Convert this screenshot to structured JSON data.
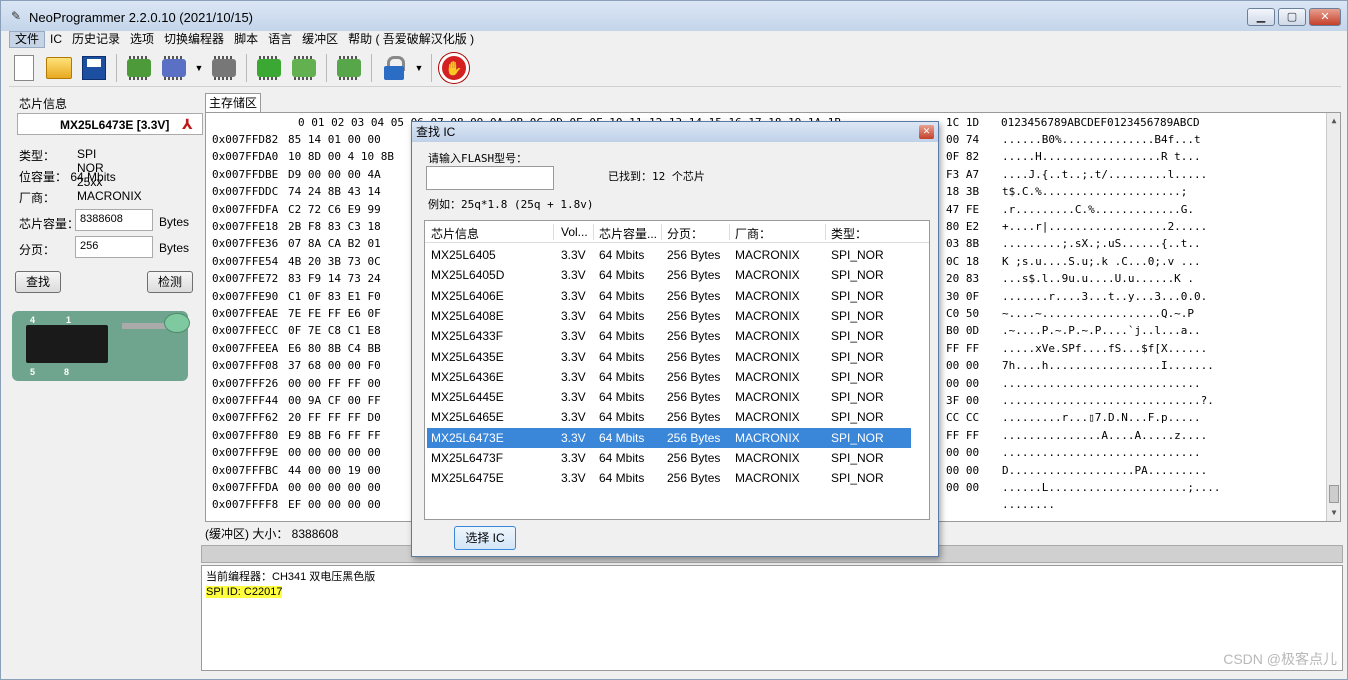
{
  "window": {
    "title": "NeoProgrammer 2.2.0.10 (2021/10/15)"
  },
  "menu": [
    "文件",
    "IC",
    "历史记录",
    "选项",
    "切换编程器",
    "脚本",
    "语言",
    "缓冲区",
    "帮助 ( 吾爱破解汉化版 )"
  ],
  "left_panel": {
    "group_label": "芯片信息",
    "chip_name": "MX25L6473E [3.3V]",
    "type_label": "类型：",
    "type_value": "SPI NOR 25xx",
    "capacity_label": "位容量：",
    "capacity_value": "64 Mbits",
    "vendor_label": "厂商：",
    "vendor_value": "MACRONIX",
    "chip_size_label": "芯片容量：",
    "chip_size_value": "8388608",
    "chip_size_unit": "Bytes",
    "page_label": "分页：",
    "page_value": "256",
    "page_unit": "Bytes",
    "find_button": "查找",
    "detect_button": "检测",
    "pin_1": "1",
    "pin_4": "4",
    "pin_5": "5",
    "pin_8": "8"
  },
  "main": {
    "tab_label": "主存储区",
    "hex_header": "0 01 02 03 04 05 06 07 08 09 0A 0B 0C 0D 0E 0F 10 11 12 13 14 15 16 17 18 19 1A 1B",
    "hex_header_tail": "1C 1D",
    "ascii_header": "0123456789ABCDEF0123456789ABCD",
    "rows": [
      {
        "addr": "0x007FFD82",
        "bytes": "85 14 01 00 00",
        "tail": "00 74",
        "ascii": "......B0%..............B4f...t"
      },
      {
        "addr": "0x007FFDA0",
        "bytes": "10 8D 00 4 10 8B",
        "tail": "0F 82",
        "ascii": ".....H..................R t..."
      },
      {
        "addr": "0x007FFDBE",
        "bytes": "D9 00 00 00 4A",
        "tail": "F3 A7",
        "ascii": "....J.{..t..;.t/.........l....."
      },
      {
        "addr": "0x007FFDDC",
        "bytes": "74 24 8B 43 14",
        "tail": "18 3B",
        "ascii": "t$.C.%.....................;"
      },
      {
        "addr": "0x007FFDFA",
        "bytes": "C2 72 C6 E9 99",
        "tail": "47 FE",
        "ascii": ".r.........C.%.............G."
      },
      {
        "addr": "0x007FFE18",
        "bytes": "2B F8 83 C3 18",
        "tail": "80 E2",
        "ascii": "+....r|..................2....."
      },
      {
        "addr": "0x007FFE36",
        "bytes": "07 8A CA B2 01",
        "tail": "03 8B",
        "ascii": ".........;.sX.;.uS......{..t.."
      },
      {
        "addr": "0x007FFE54",
        "bytes": "4B 20 3B 73 0C",
        "tail": "0C 18",
        "ascii": "K ;s.u....S.u;.k .C...0;.v ..."
      },
      {
        "addr": "0x007FFE72",
        "bytes": "83 F9 14 73 24",
        "tail": "20 83",
        "ascii": "...s$.l..9u.u....U.u......K ."
      },
      {
        "addr": "0x007FFE90",
        "bytes": "C1 0F 83 E1 F0",
        "tail": "30 0F",
        "ascii": ".......r....3...t..y...3...0.0."
      },
      {
        "addr": "0x007FFEAE",
        "bytes": "7E FE FF E6 0F",
        "tail": "C0 50",
        "ascii": "~....~..................Q.~.P"
      },
      {
        "addr": "0x007FFECC",
        "bytes": "0F 7E C8 C1 E8",
        "tail": "B0 0D",
        "ascii": ".~....P.~.P.~.P....`j..l...a.."
      },
      {
        "addr": "0x007FFEEA",
        "bytes": "E6 80 8B C4 BB",
        "tail": "FF FF",
        "ascii": ".....xVe.SPf....fS...$f[X......"
      },
      {
        "addr": "0x007FFF08",
        "bytes": "37 68 00 00 F0",
        "tail": "00 00",
        "ascii": "7h....h.................I......."
      },
      {
        "addr": "0x007FFF26",
        "bytes": "00 00 FF FF 00",
        "tail": "00 00",
        "ascii": ".............................."
      },
      {
        "addr": "0x007FFF44",
        "bytes": "00 9A CF 00 FF",
        "tail": "3F 00",
        "ascii": "..............................?."
      },
      {
        "addr": "0x007FFF62",
        "bytes": "20 FF FF FF D0",
        "tail": "CC CC",
        "ascii": ".........r...▯7.D.N...F.p....."
      },
      {
        "addr": "0x007FFF80",
        "bytes": "E9 8B F6 FF FF",
        "tail": "FF FF",
        "ascii": "...............A....A.....z...."
      },
      {
        "addr": "0x007FFF9E",
        "bytes": "00 00 00 00 00",
        "tail": "00 00",
        "ascii": ".............................."
      },
      {
        "addr": "0x007FFFBC",
        "bytes": "44 00 00 19 00",
        "tail": "00 00",
        "ascii": "D...................PA........."
      },
      {
        "addr": "0x007FFFDA",
        "bytes": "00 00 00 00 00",
        "tail": "00 00",
        "ascii": "......L.....................;...."
      },
      {
        "addr": "0x007FFFF8",
        "bytes": "EF 00 00 00 00",
        "tail": "",
        "ascii": "........"
      }
    ]
  },
  "buffer": {
    "label": "(缓冲区) 大小：",
    "size": "8388608"
  },
  "log": {
    "line1": "当前编程器：CH341 双电压黑色版",
    "line2": "SPI ID: C22017"
  },
  "watermark": "CSDN @极客点儿",
  "dialog": {
    "title": "查找 IC",
    "input_label": "请输入FLASH型号：",
    "found_text": "已找到：12 个芯片",
    "example_text": "例如：25q*1.8 (25q + 1.8v)",
    "columns": [
      "芯片信息",
      "Vol...",
      "芯片容量...",
      "分页：",
      "厂商：",
      "类型："
    ],
    "rows": [
      [
        "MX25L6405",
        "3.3V",
        "64 Mbits",
        "256 Bytes",
        "MACRONIX",
        "SPI_NOR"
      ],
      [
        "MX25L6405D",
        "3.3V",
        "64 Mbits",
        "256 Bytes",
        "MACRONIX",
        "SPI_NOR"
      ],
      [
        "MX25L6406E",
        "3.3V",
        "64 Mbits",
        "256 Bytes",
        "MACRONIX",
        "SPI_NOR"
      ],
      [
        "MX25L6408E",
        "3.3V",
        "64 Mbits",
        "256 Bytes",
        "MACRONIX",
        "SPI_NOR"
      ],
      [
        "MX25L6433F",
        "3.3V",
        "64 Mbits",
        "256 Bytes",
        "MACRONIX",
        "SPI_NOR"
      ],
      [
        "MX25L6435E",
        "3.3V",
        "64 Mbits",
        "256 Bytes",
        "MACRONIX",
        "SPI_NOR"
      ],
      [
        "MX25L6436E",
        "3.3V",
        "64 Mbits",
        "256 Bytes",
        "MACRONIX",
        "SPI_NOR"
      ],
      [
        "MX25L6445E",
        "3.3V",
        "64 Mbits",
        "256 Bytes",
        "MACRONIX",
        "SPI_NOR"
      ],
      [
        "MX25L6465E",
        "3.3V",
        "64 Mbits",
        "256 Bytes",
        "MACRONIX",
        "SPI_NOR"
      ],
      [
        "MX25L6473E",
        "3.3V",
        "64 Mbits",
        "256 Bytes",
        "MACRONIX",
        "SPI_NOR"
      ],
      [
        "MX25L6473F",
        "3.3V",
        "64 Mbits",
        "256 Bytes",
        "MACRONIX",
        "SPI_NOR"
      ],
      [
        "MX25L6475E",
        "3.3V",
        "64 Mbits",
        "256 Bytes",
        "MACRONIX",
        "SPI_NOR"
      ]
    ],
    "selected_row": 9,
    "select_button": "选择 IC"
  },
  "colors": {
    "selection": "#3a86d8",
    "highlight": "#ffff40",
    "stop": "#d42020"
  }
}
